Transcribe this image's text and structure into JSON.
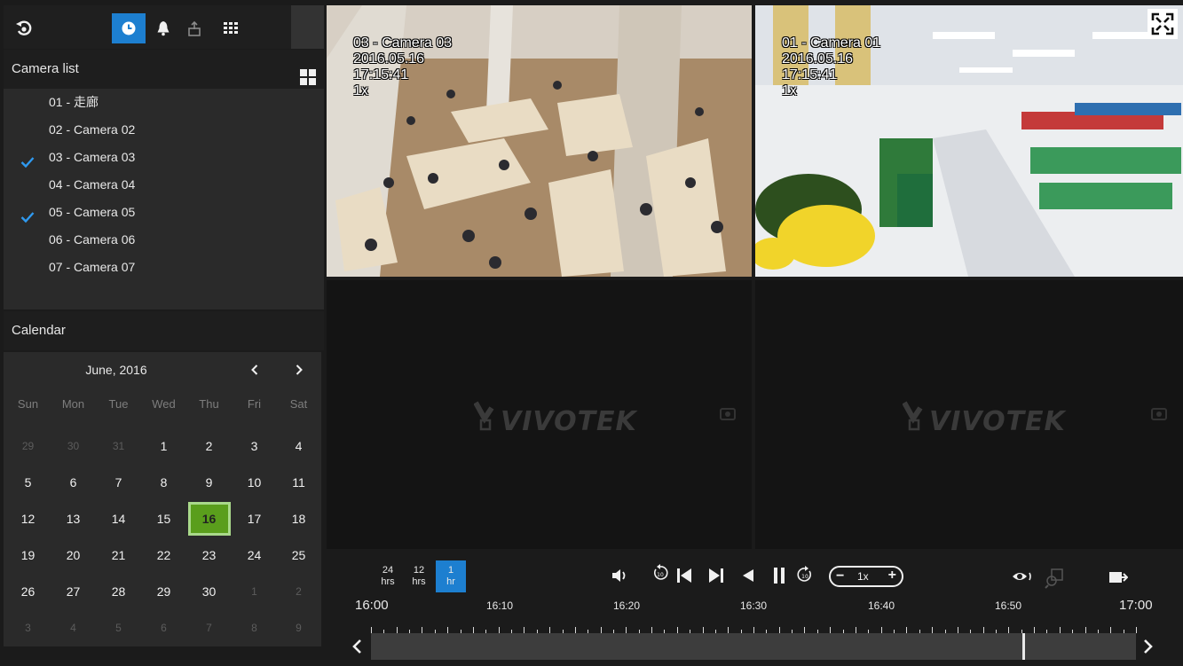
{
  "toolbar": {
    "items": [
      "back-icon",
      "playback-clock-icon",
      "alarm-bell-icon",
      "export-icon",
      "layout-grid-icon"
    ],
    "active": "playback-clock-icon"
  },
  "camera_list": {
    "title": "Camera list",
    "items": [
      {
        "label": "01 - 走廊",
        "checked": false
      },
      {
        "label": "02 - Camera 02",
        "checked": false
      },
      {
        "label": "03 - Camera 03",
        "checked": true
      },
      {
        "label": "04 - Camera 04",
        "checked": false
      },
      {
        "label": "05 - Camera 05",
        "checked": true
      },
      {
        "label": "06 - Camera 06",
        "checked": false
      },
      {
        "label": "07 - Camera 07",
        "checked": false
      }
    ]
  },
  "calendar": {
    "title": "Calendar",
    "month": "June, 2016",
    "weekdays": [
      "Sun",
      "Mon",
      "Tue",
      "Wed",
      "Thu",
      "Fri",
      "Sat"
    ],
    "weeks": [
      [
        "29",
        "30",
        "31",
        "1",
        "2",
        "3",
        "4"
      ],
      [
        "5",
        "6",
        "7",
        "8",
        "9",
        "10",
        "11"
      ],
      [
        "12",
        "13",
        "14",
        "15",
        "16",
        "17",
        "18"
      ],
      [
        "19",
        "20",
        "21",
        "22",
        "23",
        "24",
        "25"
      ],
      [
        "26",
        "27",
        "28",
        "29",
        "30",
        "1",
        "2"
      ],
      [
        "3",
        "4",
        "5",
        "6",
        "7",
        "8",
        "9"
      ]
    ],
    "selected": "16"
  },
  "views": [
    {
      "name": "03 - Camera 03",
      "date": "2016.05.16",
      "time": "17:15:41",
      "speed": "1x"
    },
    {
      "name": "01 - Camera 01",
      "date": "2016.05.16",
      "time": "17:15:41",
      "speed": "1x"
    }
  ],
  "empty_logo": "VIVOTEK",
  "playback": {
    "ranges": [
      {
        "top": "24",
        "bottom": "hrs"
      },
      {
        "top": "12",
        "bottom": "hrs"
      },
      {
        "top": "1",
        "bottom": "hr"
      }
    ],
    "active_range": 2,
    "speed": "1x",
    "timeline": {
      "start": "16:00",
      "end": "17:00",
      "labels": [
        "16:10",
        "16:20",
        "16:30",
        "16:40",
        "16:50"
      ],
      "position_fraction": 0.852
    }
  }
}
